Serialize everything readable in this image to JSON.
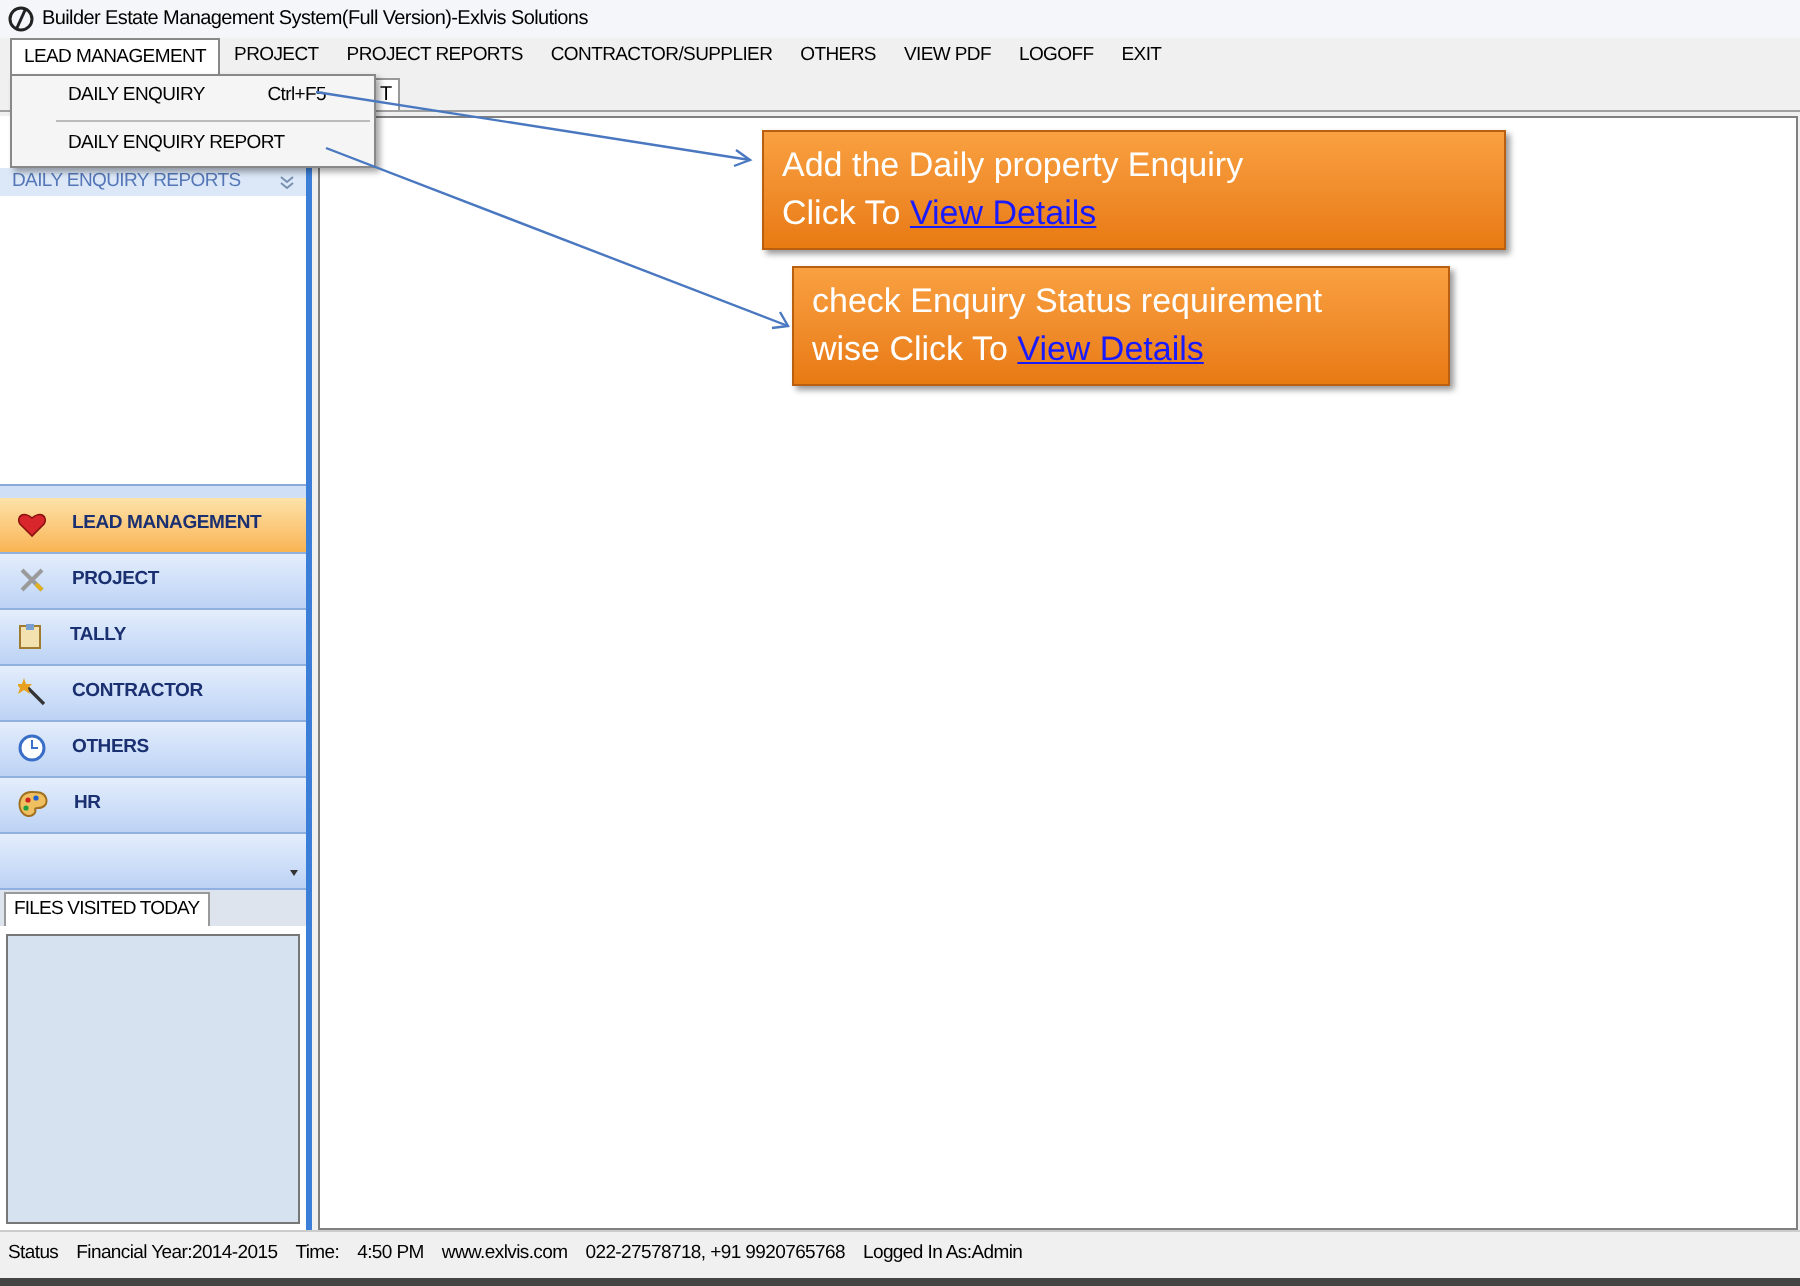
{
  "window": {
    "title": "Builder Estate Management System(Full Version)-Exlvis Solutions"
  },
  "menu_bar": [
    {
      "label": "LEAD MANAGEMENT",
      "selected": true
    },
    {
      "label": "PROJECT",
      "selected": false
    },
    {
      "label": "PROJECT REPORTS",
      "selected": false
    },
    {
      "label": "CONTRACTOR/SUPPLIER",
      "selected": false
    },
    {
      "label": "OTHERS",
      "selected": false
    },
    {
      "label": "VIEW PDF",
      "selected": false
    },
    {
      "label": "LOGOFF",
      "selected": false
    },
    {
      "label": "EXIT",
      "selected": false
    }
  ],
  "dropdown": [
    {
      "label": "DAILY ENQUIRY",
      "shortcut": "Ctrl+F5"
    },
    {
      "label": "DAILY ENQUIRY REPORT"
    }
  ],
  "tab_fragment": "T",
  "sidebar": {
    "header": "DAILY ENQUIRY REPORTS",
    "nav": [
      {
        "label": "LEAD MANAGEMENT",
        "selected": true
      },
      {
        "label": "PROJECT",
        "selected": false
      },
      {
        "label": "TALLY",
        "selected": false
      },
      {
        "label": "CONTRACTOR",
        "selected": false
      },
      {
        "label": "OTHERS",
        "selected": false
      },
      {
        "label": "HR",
        "selected": false
      }
    ],
    "files_tab": "FILES VISITED TODAY"
  },
  "callouts": [
    {
      "lines": [
        "Add the Daily property Enquiry",
        "Click To"
      ],
      "link": "View Details"
    },
    {
      "lines": [
        "check Enquiry Status requirement",
        "wise Click To"
      ],
      "link": "View Details"
    }
  ],
  "status_bar": [
    "Status",
    "Financial Year:2014-2015",
    "Time:",
    "4:50 PM",
    "www.exlvis.com",
    "022-27578718, +91 9920765768",
    "Logged In As:Admin"
  ]
}
